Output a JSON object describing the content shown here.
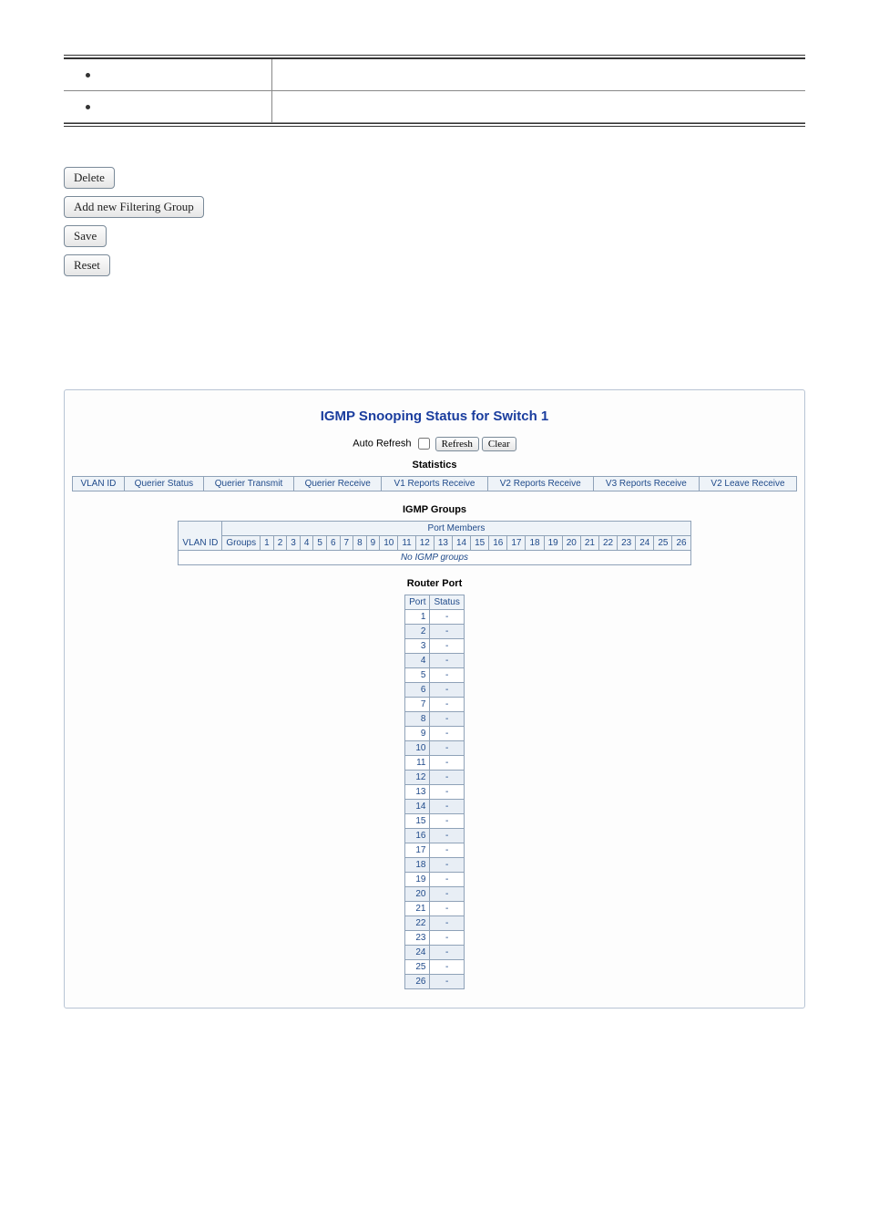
{
  "topTable": {
    "row1_left": "",
    "row1_right": "",
    "row2_left": "",
    "row2_right": ""
  },
  "actions": {
    "delete": "Delete",
    "addGroup": "Add new Filtering Group",
    "save": "Save",
    "reset": "Reset"
  },
  "panel": {
    "title": "IGMP Snooping Status for Switch 1",
    "autoRefresh": "Auto Refresh",
    "refresh": "Refresh",
    "clear": "Clear",
    "statsHeading": "Statistics",
    "statsCols": [
      "VLAN ID",
      "Querier Status",
      "Querier Transmit",
      "Querier Receive",
      "V1 Reports Receive",
      "V2 Reports Receive",
      "V3 Reports Receive",
      "V2 Leave Receive"
    ],
    "groupsHeading": "IGMP Groups",
    "portMembers": "Port Members",
    "vlanId": "VLAN ID",
    "groups": "Groups",
    "ports": [
      "1",
      "2",
      "3",
      "4",
      "5",
      "6",
      "7",
      "8",
      "9",
      "10",
      "11",
      "12",
      "13",
      "14",
      "15",
      "16",
      "17",
      "18",
      "19",
      "20",
      "21",
      "22",
      "23",
      "24",
      "25",
      "26"
    ],
    "noGroups": "No IGMP groups",
    "routerHeading": "Router Port",
    "routerCols": [
      "Port",
      "Status"
    ],
    "routerRows": [
      {
        "port": "1",
        "status": "-"
      },
      {
        "port": "2",
        "status": "-"
      },
      {
        "port": "3",
        "status": "-"
      },
      {
        "port": "4",
        "status": "-"
      },
      {
        "port": "5",
        "status": "-"
      },
      {
        "port": "6",
        "status": "-"
      },
      {
        "port": "7",
        "status": "-"
      },
      {
        "port": "8",
        "status": "-"
      },
      {
        "port": "9",
        "status": "-"
      },
      {
        "port": "10",
        "status": "-"
      },
      {
        "port": "11",
        "status": "-"
      },
      {
        "port": "12",
        "status": "-"
      },
      {
        "port": "13",
        "status": "-"
      },
      {
        "port": "14",
        "status": "-"
      },
      {
        "port": "15",
        "status": "-"
      },
      {
        "port": "16",
        "status": "-"
      },
      {
        "port": "17",
        "status": "-"
      },
      {
        "port": "18",
        "status": "-"
      },
      {
        "port": "19",
        "status": "-"
      },
      {
        "port": "20",
        "status": "-"
      },
      {
        "port": "21",
        "status": "-"
      },
      {
        "port": "22",
        "status": "-"
      },
      {
        "port": "23",
        "status": "-"
      },
      {
        "port": "24",
        "status": "-"
      },
      {
        "port": "25",
        "status": "-"
      },
      {
        "port": "26",
        "status": "-"
      }
    ]
  }
}
